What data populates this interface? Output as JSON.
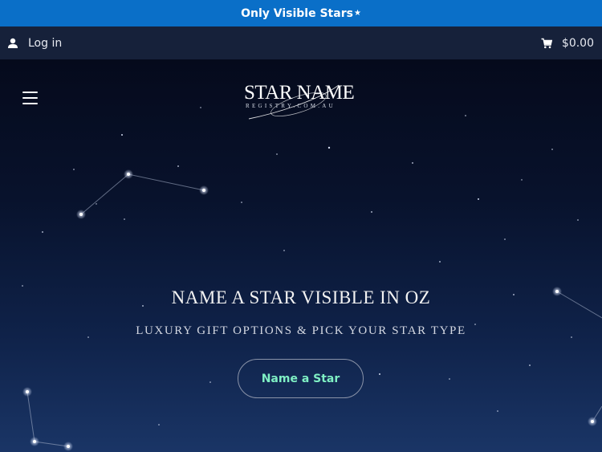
{
  "promo": {
    "text": "Only Visible Stars",
    "star_glyph": "★"
  },
  "account": {
    "login_label": "Log in",
    "cart_total": "$0.00"
  },
  "header": {
    "logo": {
      "main": "STAR NAME",
      "sub": "REGISTRY.COM.AU"
    }
  },
  "hero": {
    "title": "NAME A STAR VISIBLE IN OZ",
    "subtitle": "LUXURY GIFT OPTIONS & PICK YOUR STAR TYPE",
    "cta_label": "Name a Star"
  },
  "icons": {
    "login": "user-icon",
    "cart": "cart-icon",
    "menu": "hamburger-menu-icon"
  },
  "colors": {
    "promo_bg": "#0a6fc8",
    "account_bg": "#16213a",
    "cta_text": "#7ff0c4"
  }
}
